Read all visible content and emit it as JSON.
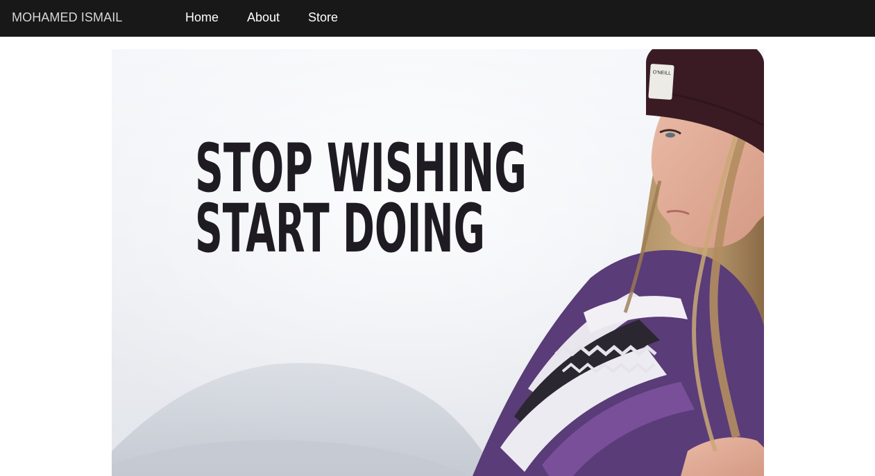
{
  "navbar": {
    "brand": "MOHAMED ISMAIL",
    "links": [
      {
        "label": "Home"
      },
      {
        "label": "About"
      },
      {
        "label": "Store"
      }
    ]
  },
  "hero": {
    "quote_line1": "STOP WISHING",
    "quote_line2": "START DOING",
    "hat_tag": "O'NEILL"
  }
}
